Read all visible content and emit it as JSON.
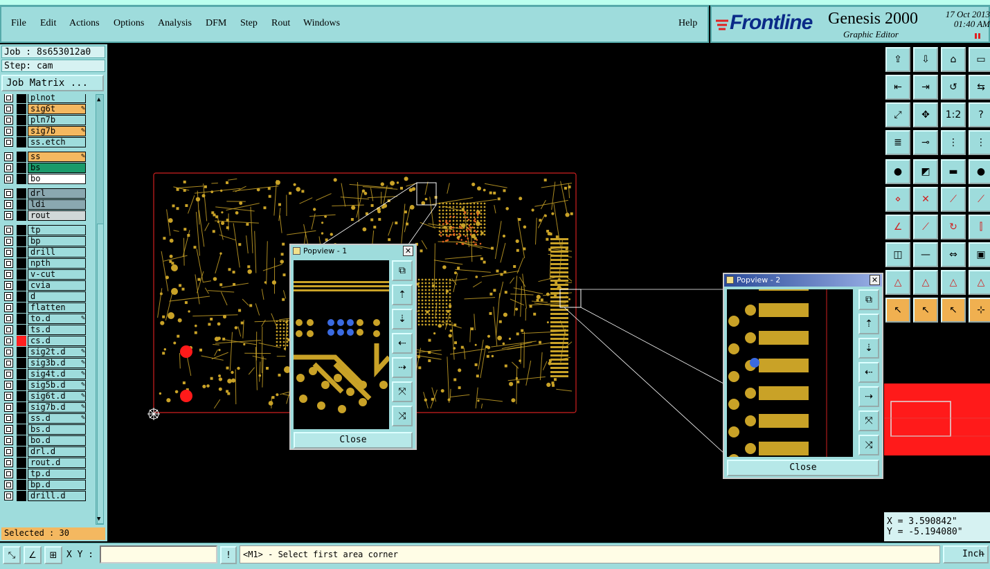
{
  "menu": {
    "items": [
      "File",
      "Edit",
      "Actions",
      "Options",
      "Analysis",
      "DFM",
      "Step",
      "Rout",
      "Windows"
    ],
    "help": "Help"
  },
  "brand": {
    "logo": "Frontline",
    "app": "Genesis 2000",
    "subtitle": "Graphic Editor",
    "date": "17 Oct 2013",
    "time": "01:40 AM"
  },
  "job": {
    "job_line": "Job : 8s653012a0",
    "step_line": "Step: cam",
    "matrix_button": "Job Matrix ..."
  },
  "layers": [
    {
      "name": "plnot",
      "color": "#9edcdc",
      "swatch": "#000",
      "edit": false
    },
    {
      "name": "sig6t",
      "color": "#f4b860",
      "swatch": "#000",
      "edit": true
    },
    {
      "name": "pln7b",
      "color": "#9edcdc",
      "swatch": "#000",
      "edit": false
    },
    {
      "name": "sig7b",
      "color": "#f4b860",
      "swatch": "#000",
      "edit": true
    },
    {
      "name": "ss.etch",
      "color": "#9edcdc",
      "swatch": "#000",
      "edit": false
    },
    {
      "name": "ss",
      "color": "#f4b860",
      "swatch": "#000",
      "edit": true
    },
    {
      "name": "bs",
      "color": "#1a9a6a",
      "swatch": "#000",
      "edit": false
    },
    {
      "name": "bo",
      "color": "#ffffff",
      "swatch": "#000",
      "edit": false
    },
    {
      "name": "drl",
      "color": "#8aa8b0",
      "swatch": "#000",
      "edit": false
    },
    {
      "name": "ldi",
      "color": "#8aa8b0",
      "swatch": "#000",
      "edit": false
    },
    {
      "name": "rout",
      "color": "#d0d8d8",
      "swatch": "#000",
      "edit": false
    },
    {
      "name": "tp",
      "color": "#9edcdc",
      "swatch": "#000",
      "edit": false
    },
    {
      "name": "bp",
      "color": "#9edcdc",
      "swatch": "#000",
      "edit": false
    },
    {
      "name": "drill",
      "color": "#9edcdc",
      "swatch": "#000",
      "edit": false
    },
    {
      "name": "npth",
      "color": "#9edcdc",
      "swatch": "#000",
      "edit": false
    },
    {
      "name": "v-cut",
      "color": "#9edcdc",
      "swatch": "#000",
      "edit": false
    },
    {
      "name": "cvia",
      "color": "#9edcdc",
      "swatch": "#000",
      "edit": false
    },
    {
      "name": "d",
      "color": "#9edcdc",
      "swatch": "#000",
      "edit": false
    },
    {
      "name": "flatten",
      "color": "#9edcdc",
      "swatch": "#000",
      "edit": false
    },
    {
      "name": "to.d",
      "color": "#9edcdc",
      "swatch": "#000",
      "edit": true
    },
    {
      "name": "ts.d",
      "color": "#9edcdc",
      "swatch": "#000",
      "edit": false
    },
    {
      "name": "cs.d",
      "color": "#9edcdc",
      "swatch": "#ff2020",
      "edit": false
    },
    {
      "name": "sig2t.d",
      "color": "#9edcdc",
      "swatch": "#000",
      "edit": true
    },
    {
      "name": "sig3b.d",
      "color": "#9edcdc",
      "swatch": "#000",
      "edit": true
    },
    {
      "name": "sig4t.d",
      "color": "#9edcdc",
      "swatch": "#000",
      "edit": true
    },
    {
      "name": "sig5b.d",
      "color": "#9edcdc",
      "swatch": "#000",
      "edit": true
    },
    {
      "name": "sig6t.d",
      "color": "#9edcdc",
      "swatch": "#000",
      "edit": true
    },
    {
      "name": "sig7b.d",
      "color": "#9edcdc",
      "swatch": "#000",
      "edit": true
    },
    {
      "name": "ss.d",
      "color": "#9edcdc",
      "swatch": "#000",
      "edit": true
    },
    {
      "name": "bs.d",
      "color": "#9edcdc",
      "swatch": "#000",
      "edit": false
    },
    {
      "name": "bo.d",
      "color": "#9edcdc",
      "swatch": "#000",
      "edit": false
    },
    {
      "name": "drl.d",
      "color": "#9edcdc",
      "swatch": "#000",
      "edit": false
    },
    {
      "name": "rout.d",
      "color": "#9edcdc",
      "swatch": "#000",
      "edit": false
    },
    {
      "name": "tp.d",
      "color": "#9edcdc",
      "swatch": "#000",
      "edit": false
    },
    {
      "name": "bp.d",
      "color": "#9edcdc",
      "swatch": "#000",
      "edit": false
    },
    {
      "name": "drill.d",
      "color": "#9edcdc",
      "swatch": "#000",
      "edit": false
    }
  ],
  "selected": "Selected : 30",
  "popview1": {
    "title": "Popview - 1",
    "close": "Close"
  },
  "popview2": {
    "title": "Popview - 2",
    "close": "Close"
  },
  "toolbar": {
    "ratio_label": "1:2",
    "help_label": "?"
  },
  "coords": {
    "x": "X =  3.590842\"",
    "y": "Y = -5.194080\""
  },
  "bottom": {
    "xy_label": "X Y :",
    "xy_value": "",
    "message": "<M1> - Select first area corner",
    "units": "Inch"
  },
  "colors": {
    "panel": "#9edcdc",
    "copper": "#c9a227",
    "board_outline": "#d02020",
    "highlight": "#f4b860"
  }
}
